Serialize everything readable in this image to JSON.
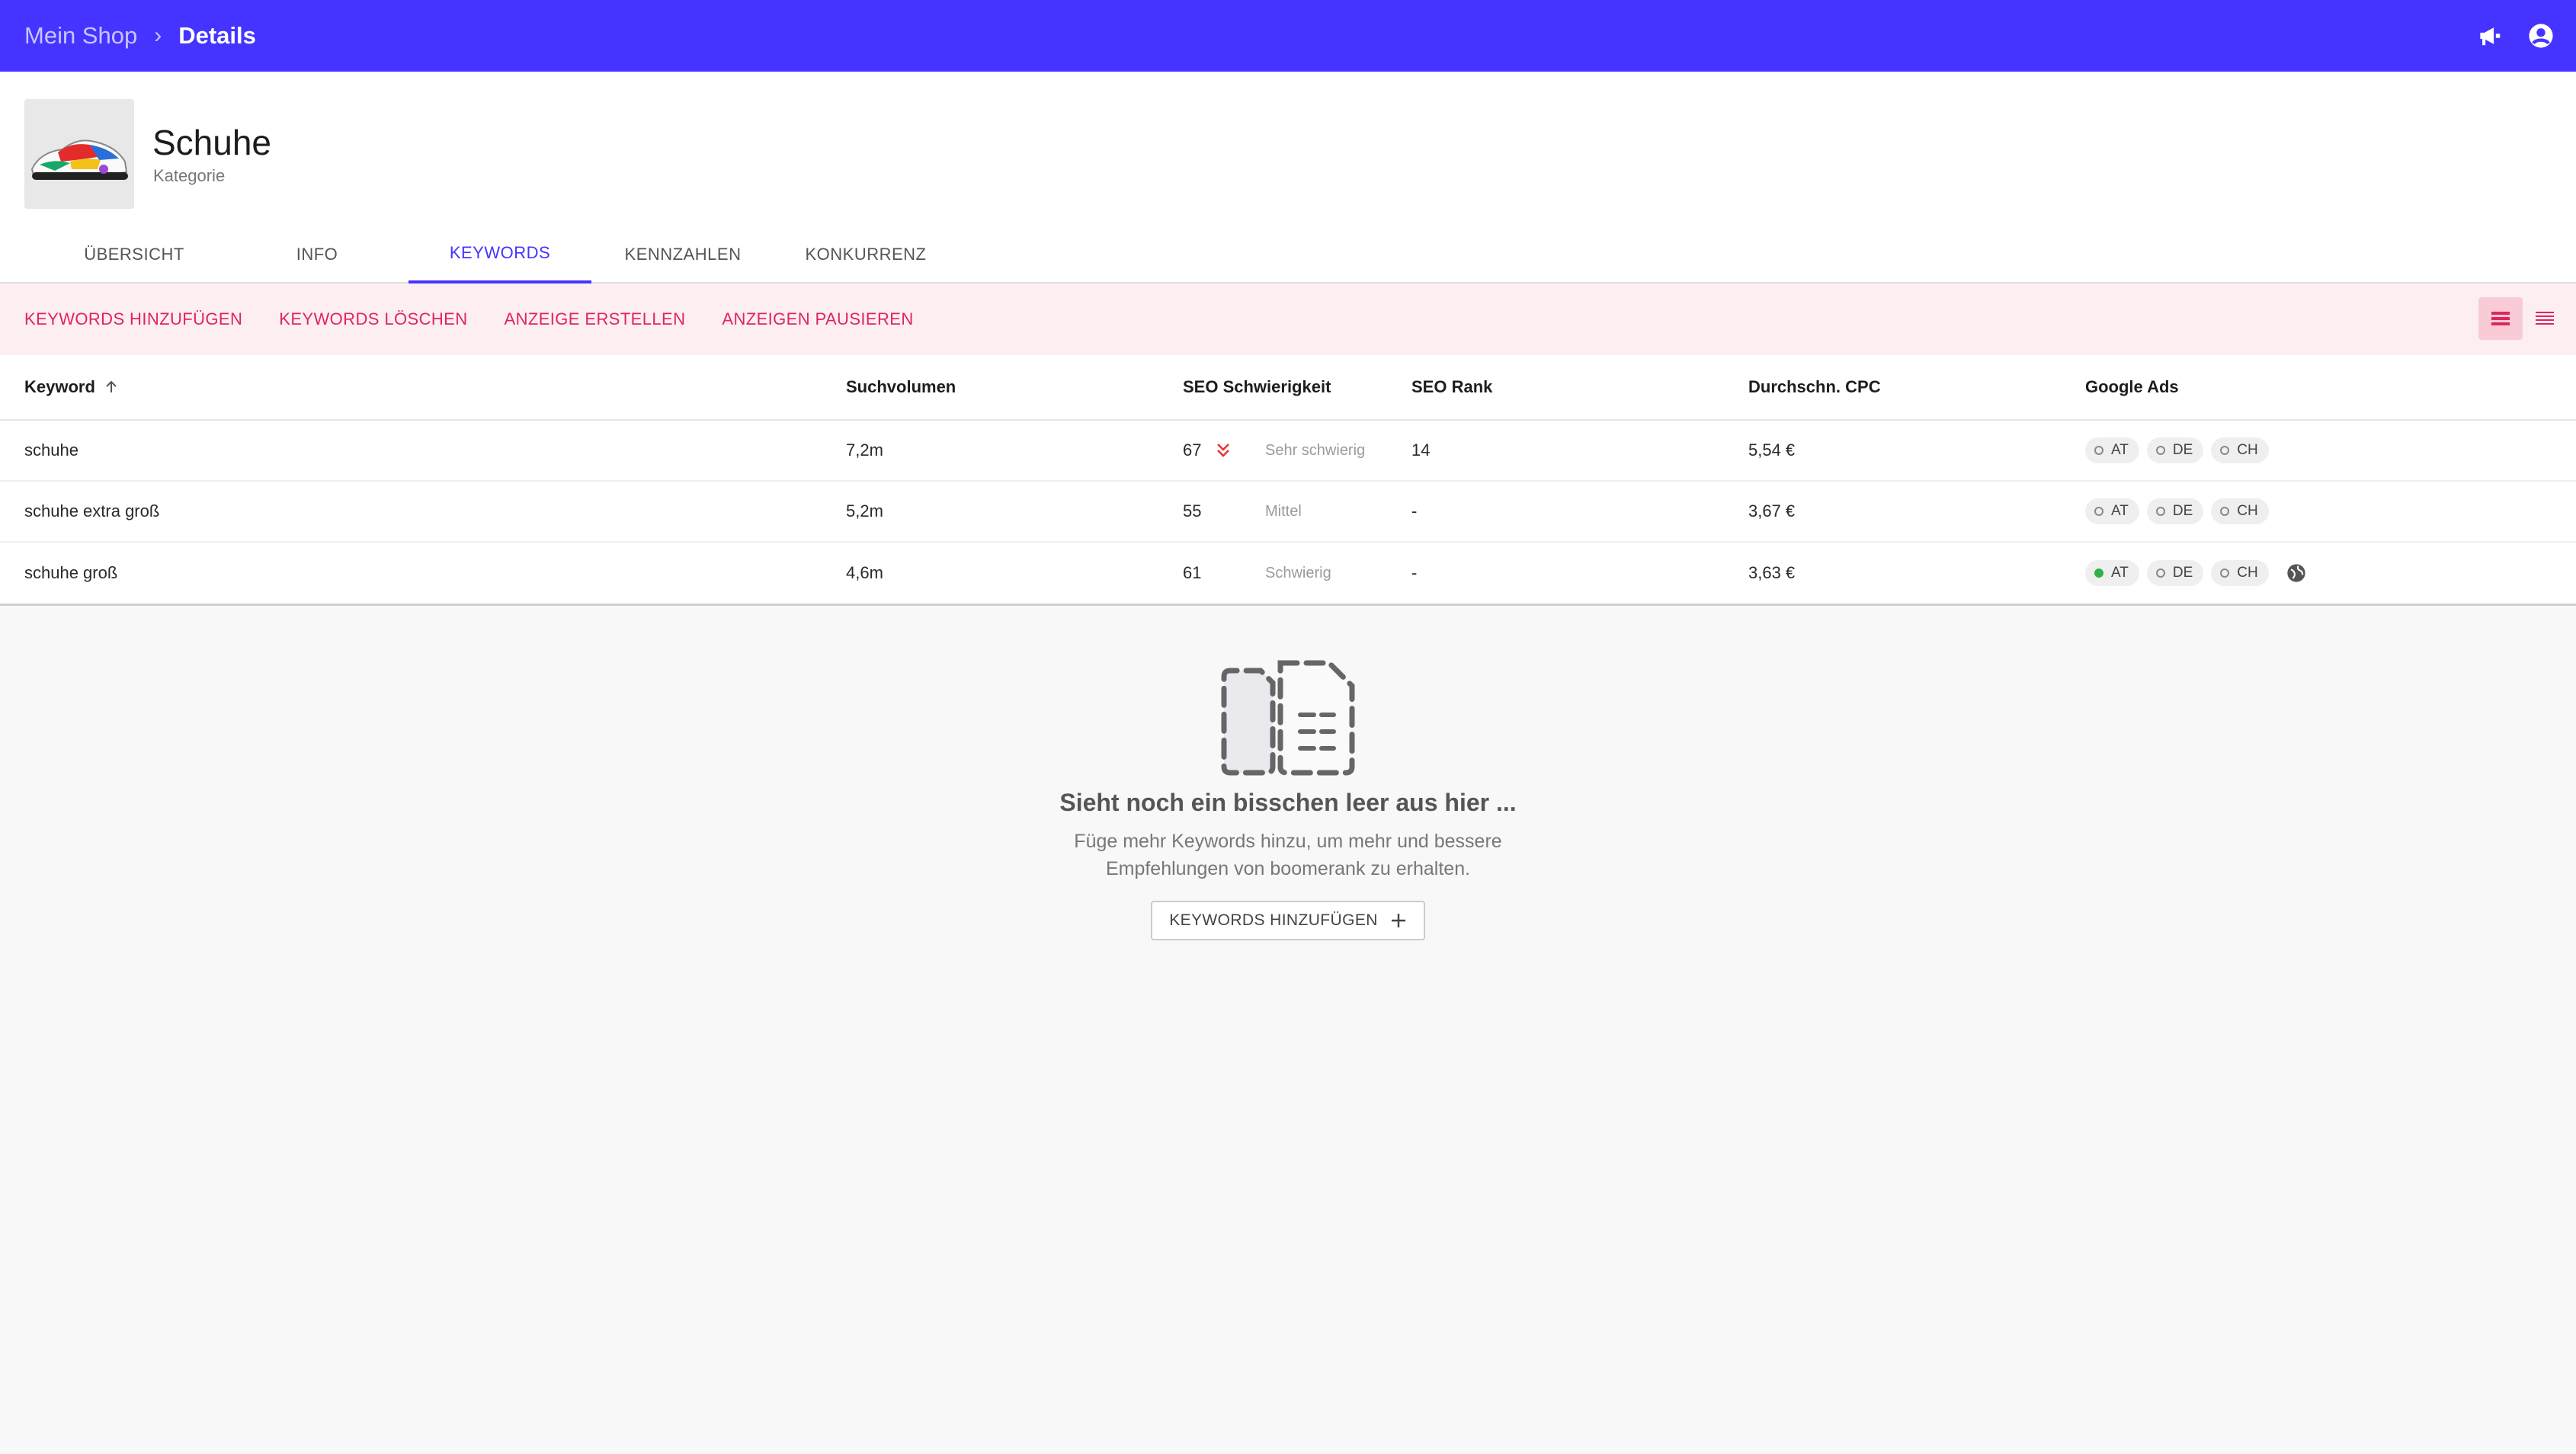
{
  "breadcrumb": {
    "root": "Mein Shop",
    "separator": "›",
    "current": "Details"
  },
  "topbar_icons": [
    "megaphone-icon",
    "account-icon"
  ],
  "header": {
    "title": "Schuhe",
    "subtitle": "Kategorie",
    "thumbnail": "sneaker-image"
  },
  "tabs": [
    {
      "label": "ÜBERSICHT",
      "active": false
    },
    {
      "label": "INFO",
      "active": false
    },
    {
      "label": "KEYWORDS",
      "active": true
    },
    {
      "label": "KENNZAHLEN",
      "active": false
    },
    {
      "label": "KONKURRENZ",
      "active": false
    }
  ],
  "actions": [
    "KEYWORDS HINZUFÜGEN",
    "KEYWORDS LÖSCHEN",
    "ANZEIGE ERSTELLEN",
    "ANZEIGEN PAUSIEREN"
  ],
  "table": {
    "columns": {
      "keyword": "Keyword",
      "volume": "Suchvolumen",
      "difficulty": "SEO Schwierigkeit",
      "rank": "SEO Rank",
      "cpc": "Durchschn. CPC",
      "ads": "Google Ads"
    },
    "rows": [
      {
        "keyword": "schuhe",
        "volume": "7,2m",
        "difficulty": "67",
        "difficulty_label": "Sehr schwierig",
        "rank": "14",
        "cpc": "5,54 €",
        "ads": [
          "AT",
          "DE",
          "CH"
        ]
      },
      {
        "keyword": "schuhe extra groß",
        "volume": "5,2m",
        "difficulty": "55",
        "difficulty_label": "Mittel",
        "rank": "-",
        "cpc": "3,67 €",
        "ads": [
          "AT",
          "DE",
          "CH"
        ]
      },
      {
        "keyword": "schuhe groß",
        "volume": "4,6m",
        "difficulty": "61",
        "difficulty_label": "Schwierig",
        "rank": "-",
        "cpc": "3,63 €",
        "ads": [
          "AT",
          "DE",
          "CH"
        ],
        "ads_active": "AT"
      }
    ]
  },
  "empty_state": {
    "title": "Sieht noch ein bisschen leer aus hier ...",
    "line1": "Füge mehr Keywords hinzu, um mehr und bessere",
    "line2": "Empfehlungen von boomerank zu erhalten.",
    "button": "KEYWORDS HINZUFÜGEN"
  },
  "colors": {
    "accent": "#4534ff",
    "action": "#e0245e",
    "action_bg": "#fdeff1",
    "ads_active": "#2fb34a"
  }
}
